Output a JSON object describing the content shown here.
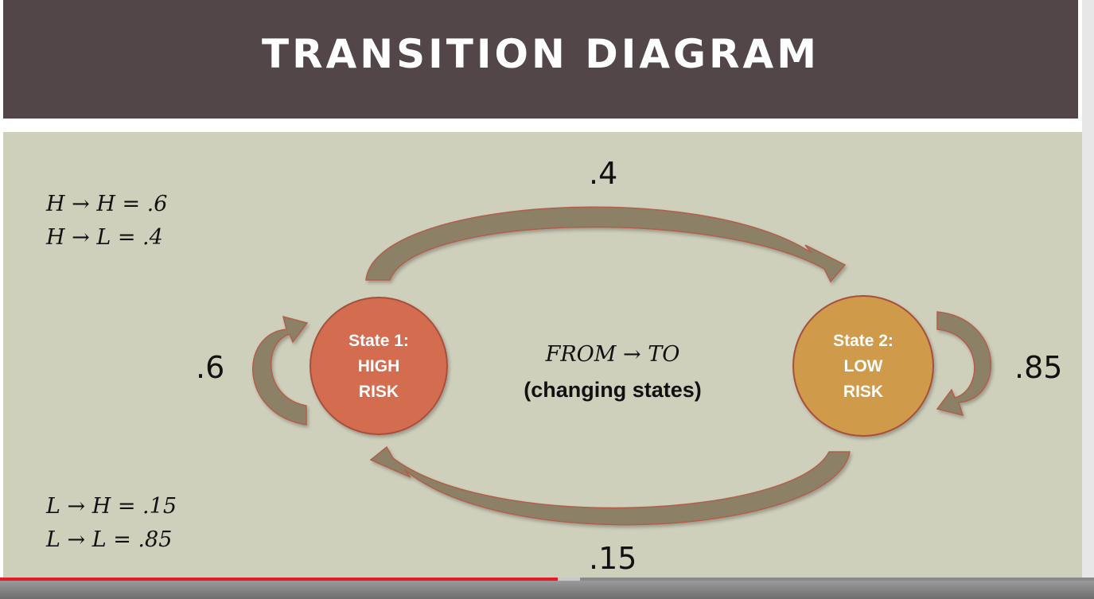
{
  "title": "TRANSITION DIAGRAM",
  "formulas_top": [
    "H → H = .6",
    "H → L = .4"
  ],
  "formulas_bottom": [
    "L → H = .15",
    "L → L = .85"
  ],
  "states": {
    "high": {
      "line1": "State 1:",
      "line2": "HIGH",
      "line3": "RISK",
      "color": "#d46c50"
    },
    "low": {
      "line1": "State 2:",
      "line2": "LOW",
      "line3": "RISK",
      "color": "#cf9a49"
    }
  },
  "center": {
    "title": "FROM → TO",
    "subtitle": "(changing states)"
  },
  "probabilities": {
    "high_to_low": ".4",
    "low_to_high": ".15",
    "high_to_high": ".6",
    "low_to_low": ".85"
  },
  "colors": {
    "title_bar": "#524649",
    "background": "#cfd0bc",
    "arrow": "#8c8066",
    "progress": "#e31b23"
  },
  "video_progress": {
    "played_fraction": 0.51,
    "buffered_fraction": 0.53
  }
}
